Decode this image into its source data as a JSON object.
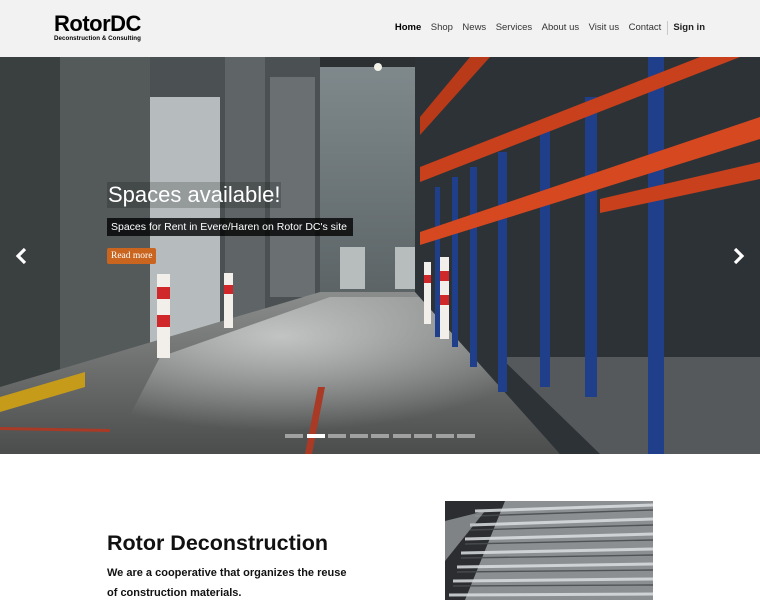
{
  "brand": {
    "name": "RotorDC",
    "tagline": "Deconstruction & Consulting"
  },
  "nav": {
    "items": [
      {
        "label": "Home",
        "active": true
      },
      {
        "label": "Shop",
        "active": false
      },
      {
        "label": "News",
        "active": false
      },
      {
        "label": "Services",
        "active": false
      },
      {
        "label": "About us",
        "active": false
      },
      {
        "label": "Visit us",
        "active": false
      },
      {
        "label": "Contact",
        "active": false
      }
    ],
    "signin_label": "Sign in"
  },
  "hero": {
    "title": "Spaces available!",
    "subtitle": "Spaces for Rent in Evere/Haren on Rotor DC's site",
    "cta_label": "Read more",
    "prev_icon": "chevron-left-icon",
    "next_icon": "chevron-right-icon",
    "slide_count": 9,
    "active_slide": 2,
    "accent_color": "#c9651f"
  },
  "intro": {
    "title": "Rotor Deconstruction",
    "text": "We are a cooperative that organizes the reuse of construction materials."
  }
}
